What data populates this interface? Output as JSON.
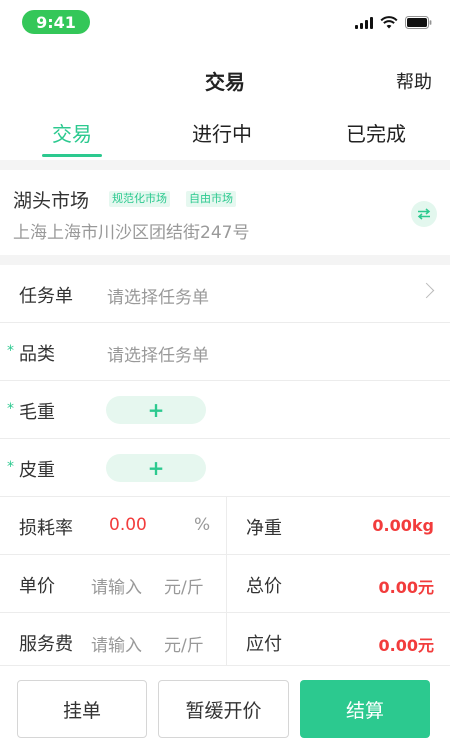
{
  "status_bar": {
    "time": "9:41"
  },
  "nav": {
    "title": "交易",
    "help": "帮助"
  },
  "tabs": [
    {
      "label": "交易",
      "active": true
    },
    {
      "label": "进行中",
      "active": false
    },
    {
      "label": "已完成",
      "active": false
    }
  ],
  "market": {
    "name": "湖头市场",
    "tags": [
      "规范化市场",
      "自由市场"
    ],
    "address": "上海上海市川沙区团结街247号"
  },
  "form": {
    "task": {
      "label": "任务单",
      "placeholder": "请选择任务单"
    },
    "category": {
      "label": "品类",
      "placeholder": "请选择任务单",
      "required": true
    },
    "gross_weight": {
      "label": "毛重",
      "add": "+",
      "required": true
    },
    "tare_weight": {
      "label": "皮重",
      "add": "+",
      "required": true
    },
    "loss_rate": {
      "label": "损耗率",
      "value": "0.00",
      "unit": "%"
    },
    "net_weight": {
      "label": "净重",
      "value": "0.00kg"
    },
    "unit_price": {
      "label": "单价",
      "placeholder": "请输入",
      "unit": "元/斤"
    },
    "total_price": {
      "label": "总价",
      "value": "0.00元"
    },
    "service_fee": {
      "label": "服务费",
      "placeholder": "请输入",
      "unit": "元/斤"
    },
    "payable": {
      "label": "应付",
      "value": "0.00元"
    },
    "required_mark": "*"
  },
  "actions": {
    "hold": "挂单",
    "defer_price": "暂缓开价",
    "settle": "结算"
  },
  "colors": {
    "accent": "#2cc98f",
    "danger": "#f23c3c",
    "status_time": "#34c759"
  }
}
